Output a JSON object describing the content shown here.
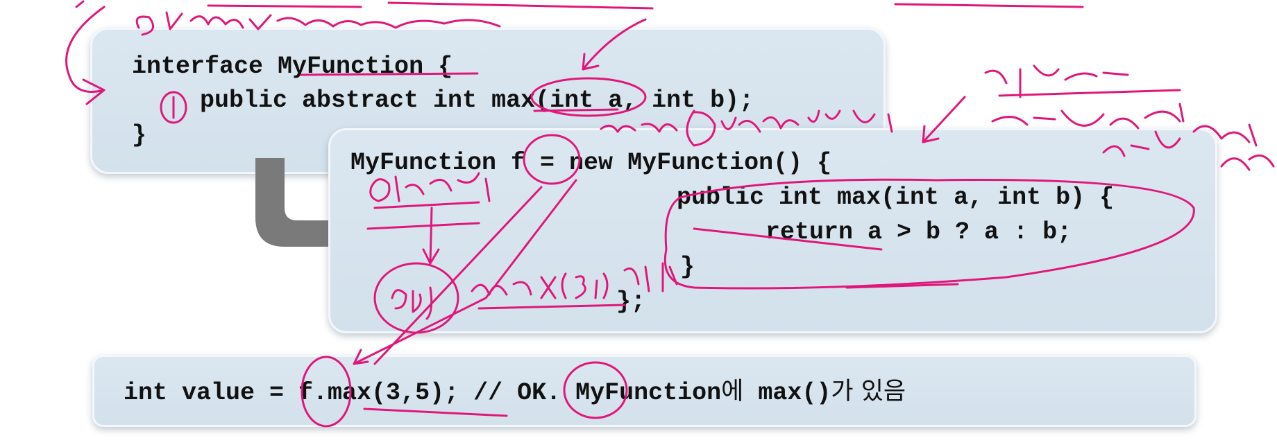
{
  "slide": {
    "interface_block": {
      "line1": "interface MyFunction {",
      "line2": "public abstract int max(int a, int b);",
      "line3": "}"
    },
    "anonymous_block": {
      "line1": "MyFunction f = new MyFunction() {",
      "line2": "public int max(int a, int b) {",
      "line3": "return a > b ? a : b;",
      "line4": "}",
      "line5": "};"
    },
    "usage_block": {
      "code": "int value = f.max(3,5); // OK. MyFunction",
      "note_ko_1": "에",
      "note_code": " max()",
      "note_ko_2": "가 있음"
    }
  },
  "colors": {
    "box_fill": "#d6e3ed",
    "arrow": "#7a7a7a",
    "annotation_ink": "#e0177a"
  }
}
